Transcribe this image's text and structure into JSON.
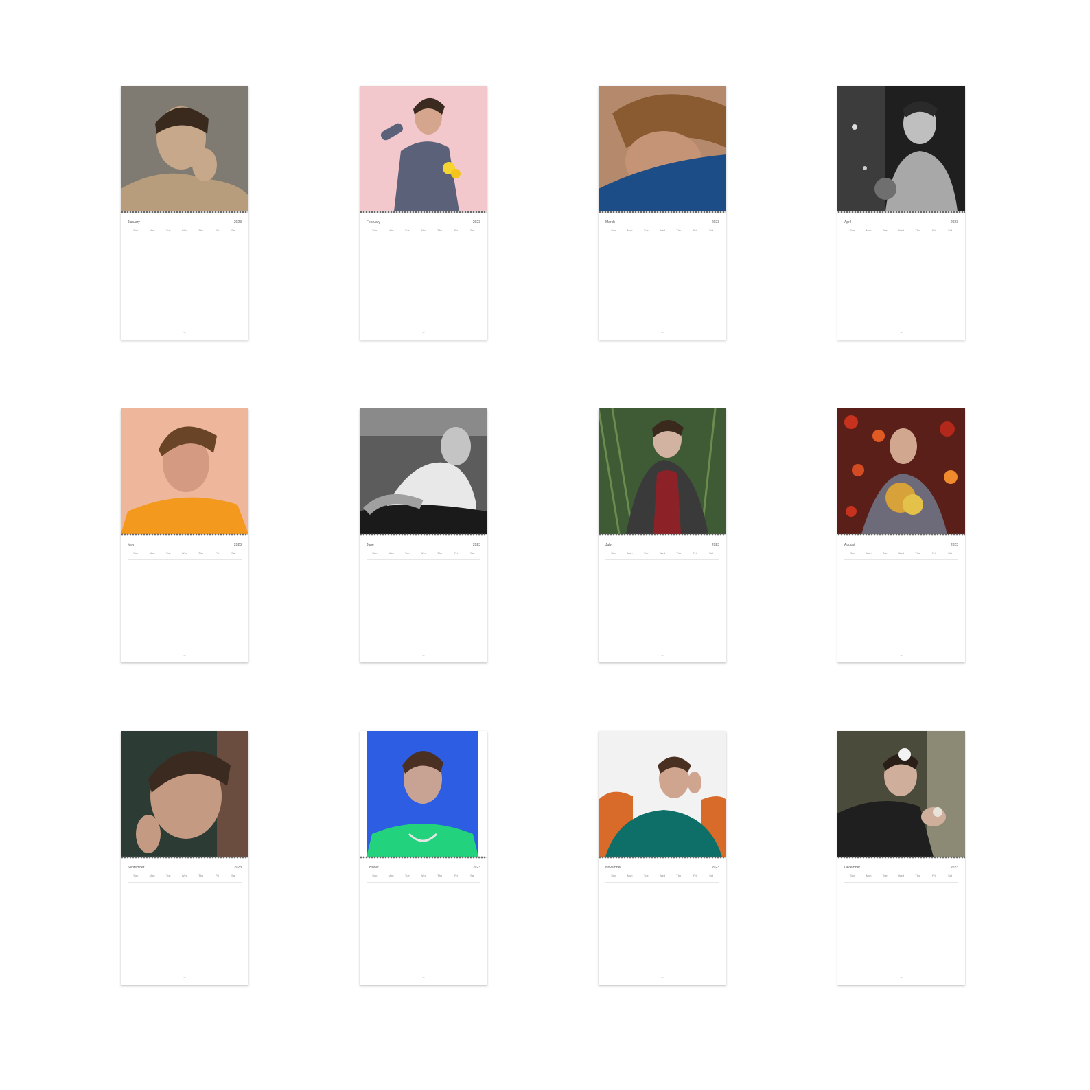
{
  "calendar": {
    "year": "2023",
    "weekdays": [
      "Sun",
      "Mon",
      "Tue",
      "Wed",
      "Thu",
      "Fri",
      "Sat"
    ],
    "months": [
      {
        "name": "January",
        "photo_colors": {
          "bg": "#7f7b72",
          "subject": "#c8a88a",
          "accent": "#b79d7b"
        }
      },
      {
        "name": "February",
        "photo_colors": {
          "bg": "#f3c8cd",
          "subject": "#d5a58e",
          "accent": "#5a6178"
        }
      },
      {
        "name": "March",
        "photo_colors": {
          "bg": "#b58a6c",
          "subject": "#c59375",
          "accent": "#1d4d86"
        }
      },
      {
        "name": "April",
        "photo_colors": {
          "bg": "#1f1f1f",
          "subject": "#bfbfbf",
          "accent": "#6f6f6f"
        }
      },
      {
        "name": "May",
        "photo_colors": {
          "bg": "#eeb79b",
          "subject": "#d49a82",
          "accent": "#f39a1e"
        }
      },
      {
        "name": "June",
        "photo_colors": {
          "bg": "#5c5c5c",
          "subject": "#c4c4c4",
          "accent": "#1a1a1a"
        }
      },
      {
        "name": "July",
        "photo_colors": {
          "bg": "#3f5b36",
          "subject": "#d2b2a0",
          "accent": "#8c2228"
        }
      },
      {
        "name": "August",
        "photo_colors": {
          "bg": "#5a1f18",
          "subject": "#d2a78f",
          "accent": "#d8a23a"
        }
      },
      {
        "name": "September",
        "photo_colors": {
          "bg": "#2d3b35",
          "subject": "#c59a82",
          "accent": "#6a4d3f"
        }
      },
      {
        "name": "October",
        "photo_colors": {
          "bg": "#2c5de3",
          "subject": "#c8a393",
          "accent": "#22d27c"
        }
      },
      {
        "name": "November",
        "photo_colors": {
          "bg": "#f2f2f2",
          "subject": "#cfa590",
          "accent": "#0e6f69"
        }
      },
      {
        "name": "December",
        "photo_colors": {
          "bg": "#4b4b3b",
          "subject": "#cfae9b",
          "accent": "#1f1f1f"
        }
      }
    ]
  },
  "weeks": [
    [
      "",
      "",
      "",
      "",
      "",
      "",
      ""
    ],
    [
      "",
      "",
      "",
      "",
      "",
      "",
      ""
    ],
    [
      "",
      "",
      "",
      "",
      "",
      "",
      ""
    ],
    [
      "",
      "",
      "",
      "",
      "",
      "",
      ""
    ],
    [
      "",
      "",
      "",
      "",
      "",
      "",
      ""
    ]
  ]
}
